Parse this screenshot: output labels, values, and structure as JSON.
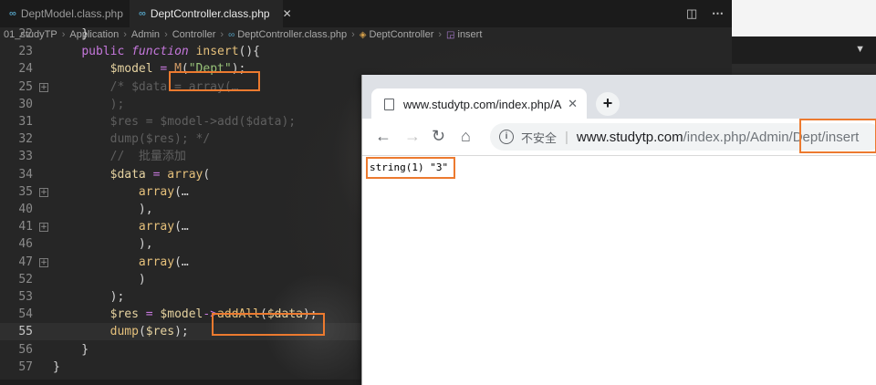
{
  "editor": {
    "tabs": [
      {
        "label": "DeptModel.class.php",
        "active": false
      },
      {
        "label": "DeptController.class.php",
        "active": true
      }
    ],
    "breadcrumb": [
      "01_studyTP",
      "Application",
      "Admin",
      "Controller",
      "DeptController.class.php",
      "DeptController",
      "insert"
    ],
    "lines": [
      {
        "n": "22",
        "text": "    }"
      },
      {
        "n": "23",
        "text": "    public function insert(){"
      },
      {
        "n": "24",
        "text": "        $model = M(\"Dept\");"
      },
      {
        "n": "25",
        "text": "        /* $data = array(…"
      },
      {
        "n": "30",
        "text": "        );"
      },
      {
        "n": "31",
        "text": "        $res = $model->add($data);"
      },
      {
        "n": "32",
        "text": "        dump($res); */"
      },
      {
        "n": "33",
        "text": "        //  批量添加"
      },
      {
        "n": "34",
        "text": "        $data = array("
      },
      {
        "n": "35",
        "text": "            array(…"
      },
      {
        "n": "40",
        "text": "            ),"
      },
      {
        "n": "41",
        "text": "            array(…"
      },
      {
        "n": "46",
        "text": "            ),"
      },
      {
        "n": "47",
        "text": "            array(…"
      },
      {
        "n": "52",
        "text": "            )"
      },
      {
        "n": "53",
        "text": "        );"
      },
      {
        "n": "54",
        "text": "        $res = $model->addAll($data);"
      },
      {
        "n": "55",
        "text": "        dump($res);"
      },
      {
        "n": "56",
        "text": "    }"
      },
      {
        "n": "57",
        "text": "}"
      }
    ],
    "current_line": "55",
    "highlight_color": "#ec7a2f"
  },
  "browser": {
    "tab_title": "www.studytp.com/index.php/A",
    "omnibox": {
      "security_label": "不安全",
      "host": "www.studytp.com",
      "path": "/index.php/Admin/",
      "path_highlight": "Dept/insert"
    },
    "output": "string(1) \"3\""
  }
}
